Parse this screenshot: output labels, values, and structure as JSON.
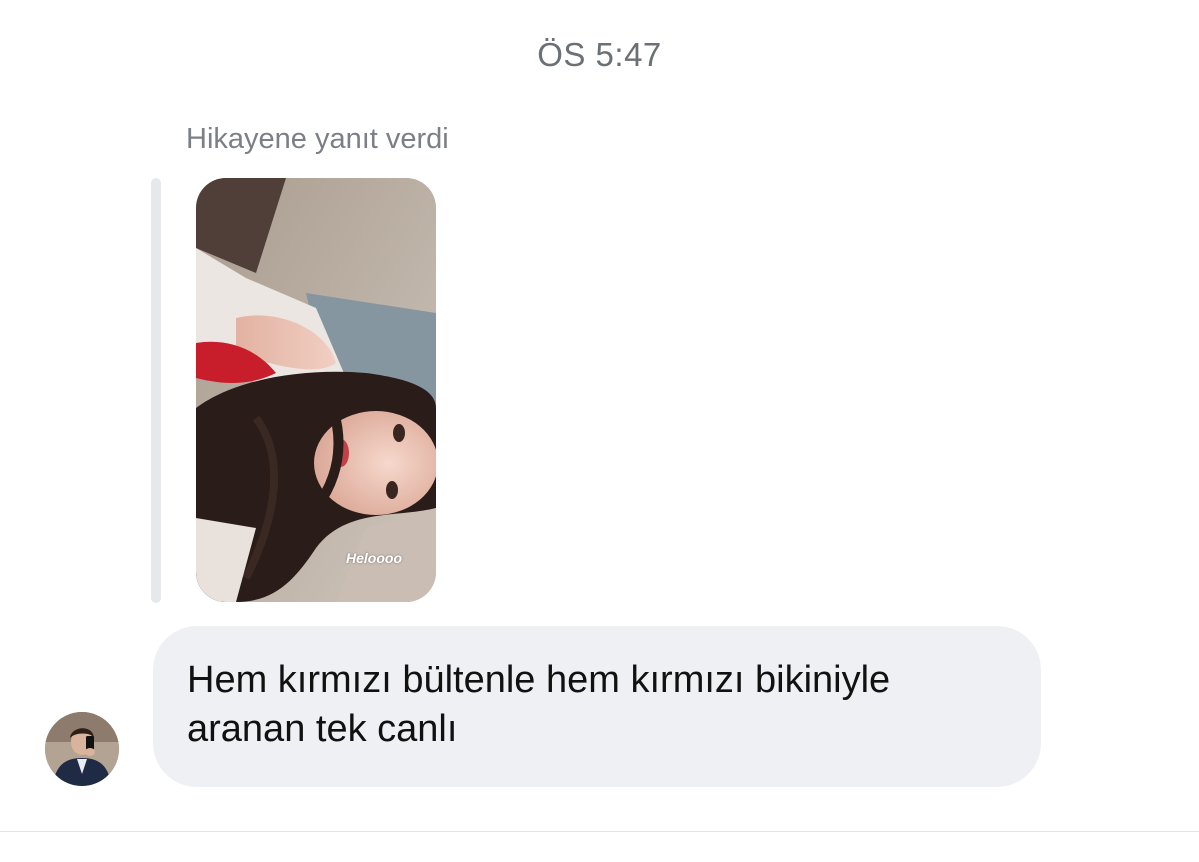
{
  "conversation": {
    "timestamp": "ÖS 5:47",
    "reply_context": "Hikayene yanıt verdi",
    "story": {
      "caption": "Heloooo"
    },
    "message": {
      "text": "Hem kırmızı bültenle hem kırmızı bikiniyle aranan tek canlı"
    }
  },
  "colors": {
    "bubble_background": "#eef0f3",
    "meta_text": "#6b6f76",
    "quote_bar": "#e6e8eb"
  },
  "icons": {
    "avatar": "sender-avatar-photo",
    "story": "story-preview-photo"
  }
}
